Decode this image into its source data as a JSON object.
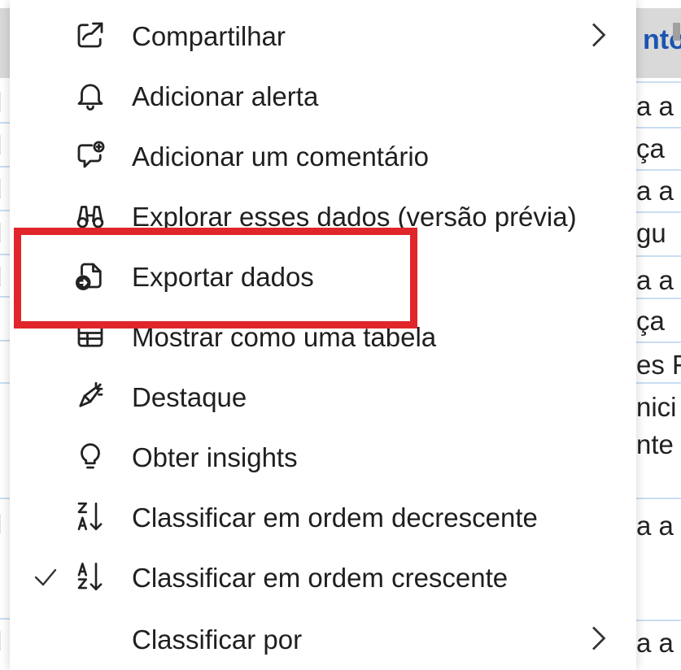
{
  "background_table": {
    "header_text": "nto",
    "left_fragments": [
      "d",
      "d",
      "d",
      "d",
      "d",
      "c",
      "c",
      "l",
      "d",
      "d"
    ],
    "right_fragments": [
      "a a",
      "ça",
      "a a",
      "gu",
      "a a",
      "ça",
      "es F",
      "nici",
      "nte",
      "a a",
      "a a"
    ]
  },
  "menu": {
    "items": [
      {
        "id": "share",
        "label": "Compartilhar",
        "icon": "share-icon",
        "submenu": true
      },
      {
        "id": "alert",
        "label": "Adicionar alerta",
        "icon": "bell-icon"
      },
      {
        "id": "comment",
        "label": "Adicionar um comentário",
        "icon": "comment-add-icon"
      },
      {
        "id": "explore",
        "label": "Explorar esses dados (versão prévia)",
        "icon": "binoculars-icon"
      },
      {
        "id": "export",
        "label": "Exportar dados",
        "icon": "export-document-icon"
      },
      {
        "id": "table",
        "label": "Mostrar como uma tabela",
        "icon": "table-view-icon"
      },
      {
        "id": "spotlight",
        "label": "Destaque",
        "icon": "spotlight-icon"
      },
      {
        "id": "insights",
        "label": "Obter insights",
        "icon": "lightbulb-icon"
      },
      {
        "id": "sort_desc",
        "label": "Classificar em ordem decrescente",
        "icon": "sort-descending-icon"
      },
      {
        "id": "sort_asc",
        "label": "Classificar em ordem crescente",
        "icon": "sort-ascending-icon",
        "checked": true
      },
      {
        "id": "sort_by",
        "label": "Classificar por",
        "icon": "",
        "submenu": true
      }
    ]
  },
  "highlight_color": "#e0262b",
  "accent_color": "#1b55b0"
}
